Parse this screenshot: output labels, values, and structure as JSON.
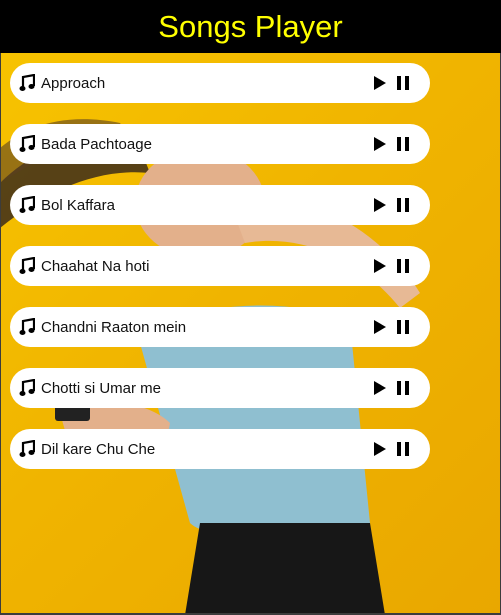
{
  "app": {
    "title": "Songs Player"
  },
  "colors": {
    "header_bg": "#000000",
    "title_color": "#ffff00",
    "background": "#f3b600",
    "card_bg": "#ffffff"
  },
  "icons": {
    "song": "music-note-icon",
    "play": "play-icon",
    "pause": "pause-icon"
  },
  "songs": [
    {
      "title": "Approach"
    },
    {
      "title": "Bada Pachtoage"
    },
    {
      "title": "Bol Kaffara"
    },
    {
      "title": "Chaahat Na hoti"
    },
    {
      "title": "Chandni Raaton mein"
    },
    {
      "title": "Chotti si Umar me"
    },
    {
      "title": "Dil kare Chu Che"
    }
  ]
}
